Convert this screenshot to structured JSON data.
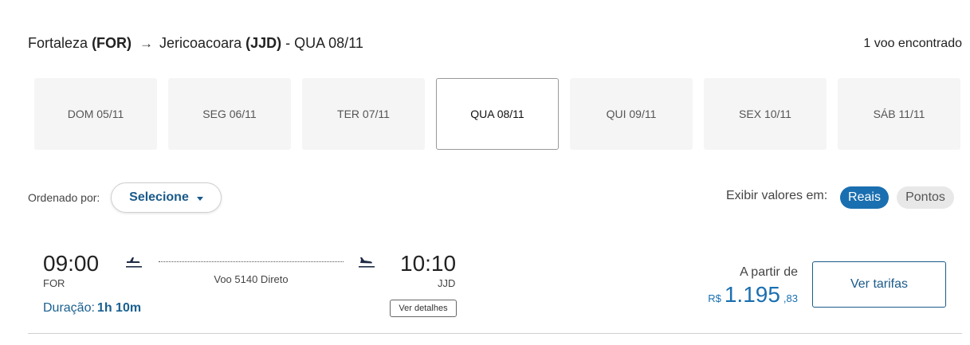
{
  "route": {
    "origin_city": "Fortaleza",
    "origin_code": "(FOR)",
    "destination_city": "Jericoacoara",
    "destination_code": "(JJD)",
    "date_suffix": "- QUA 08/11",
    "flights_found": "1 voo encontrado"
  },
  "dates": [
    {
      "label": "DOM 05/11",
      "active": false
    },
    {
      "label": "SEG 06/11",
      "active": false
    },
    {
      "label": "TER 07/11",
      "active": false
    },
    {
      "label": "QUA 08/11",
      "active": true
    },
    {
      "label": "QUI 09/11",
      "active": false
    },
    {
      "label": "SEX 10/11",
      "active": false
    },
    {
      "label": "SÁB 11/11",
      "active": false
    }
  ],
  "sort": {
    "label": "Ordenado por:",
    "selected": "Selecione"
  },
  "display_values": {
    "label": "Exibir valores em:",
    "options": [
      "Reais",
      "Pontos"
    ],
    "selected": "Reais"
  },
  "flight": {
    "departure_time": "09:00",
    "departure_code": "FOR",
    "arrival_time": "10:10",
    "arrival_code": "JJD",
    "info": "Voo 5140 Direto",
    "duration_label": "Duração:",
    "duration_value": "1h 10m",
    "details_button": "Ver detalhes",
    "price_prefix": "A partir de",
    "currency": "R$",
    "price_int": "1.195",
    "price_cents": ",83",
    "fares_button": "Ver tarifas"
  },
  "colors": {
    "accent": "#1a6fb0",
    "accent_dark": "#1a5a8a"
  },
  "icons": [
    "arrow-right-icon",
    "plane-takeoff-icon",
    "plane-landing-icon",
    "caret-down-icon"
  ]
}
